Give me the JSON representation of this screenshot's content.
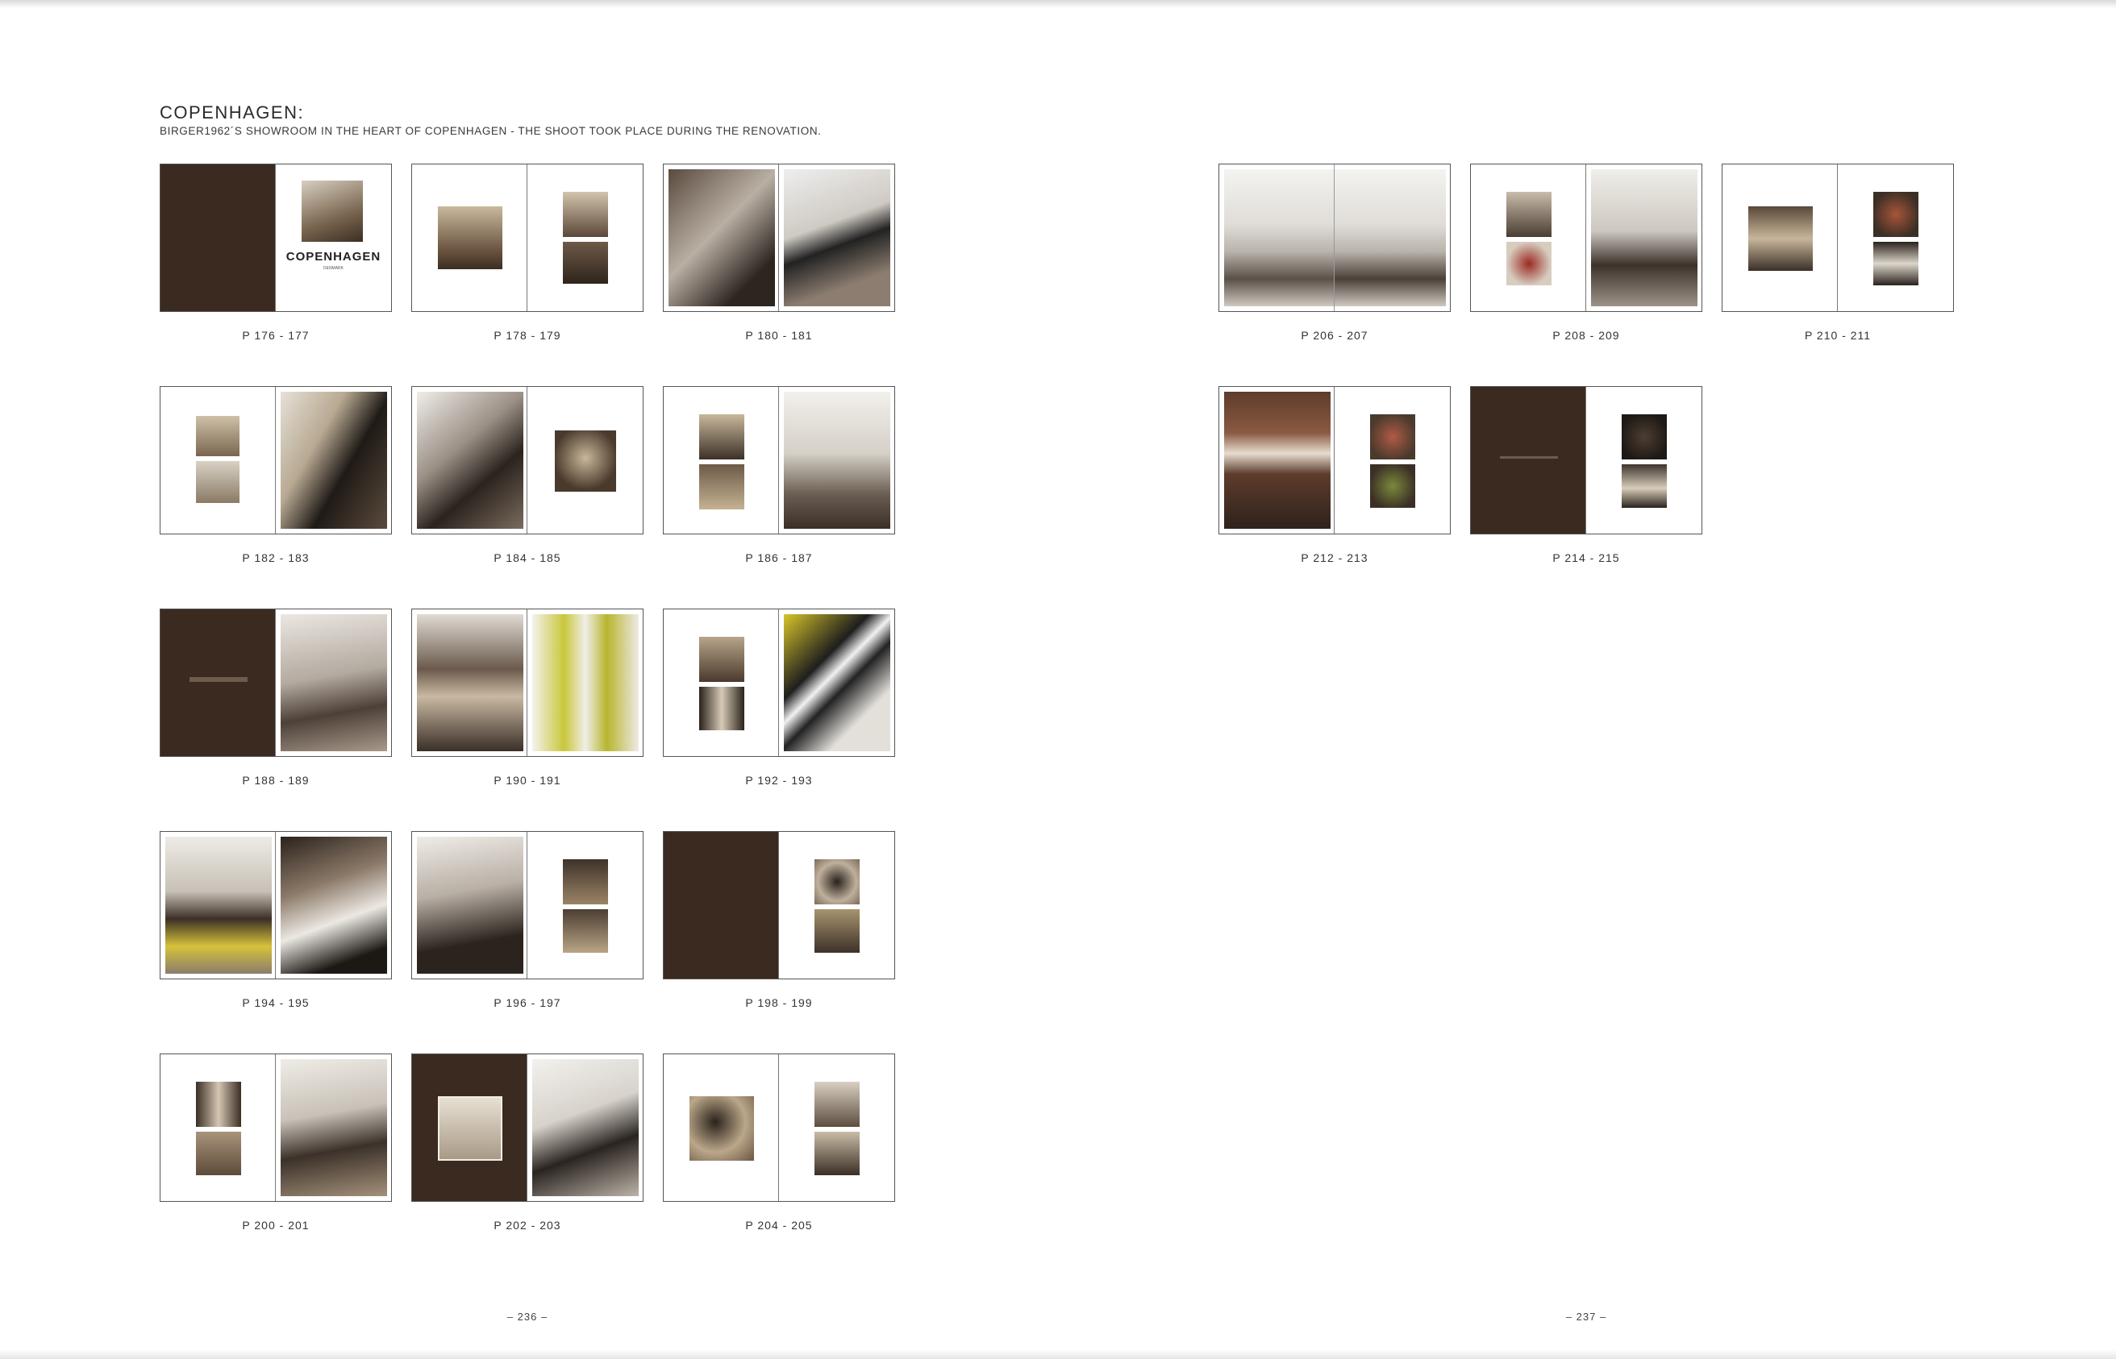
{
  "heading": {
    "title": "COPENHAGEN:",
    "subtitle": "BIRGER1962´S SHOWROOM IN THE HEART OF COPENHAGEN - THE SHOOT TOOK PLACE DURING THE RENOVATION."
  },
  "spreads": [
    {
      "label": "P 176 - 177"
    },
    {
      "label": "P 178 - 179"
    },
    {
      "label": "P 180 - 181"
    },
    {
      "label": "P 182 - 183"
    },
    {
      "label": "P 184 - 185"
    },
    {
      "label": "P 186 - 187"
    },
    {
      "label": "P 188 - 189"
    },
    {
      "label": "P 190 - 191"
    },
    {
      "label": "P 192 - 193"
    },
    {
      "label": "P 194 - 195"
    },
    {
      "label": "P 196 - 197"
    },
    {
      "label": "P 198 - 199"
    },
    {
      "label": "P 200 - 201"
    },
    {
      "label": "P 202 - 203"
    },
    {
      "label": "P 204 - 205"
    },
    {
      "label": "P 206 - 207"
    },
    {
      "label": "P 208 - 209"
    },
    {
      "label": "P 210 - 211"
    },
    {
      "label": "P 212 - 213"
    },
    {
      "label": "P 214 - 215"
    }
  ],
  "thumbnail_text": {
    "cover_title": "COPENHAGEN",
    "cover_subtitle": "DENMARK"
  },
  "folios": {
    "left": "– 236 –",
    "right": "– 237 –"
  },
  "colors": {
    "dark_page": "#3a2a20",
    "border": "#555555"
  }
}
